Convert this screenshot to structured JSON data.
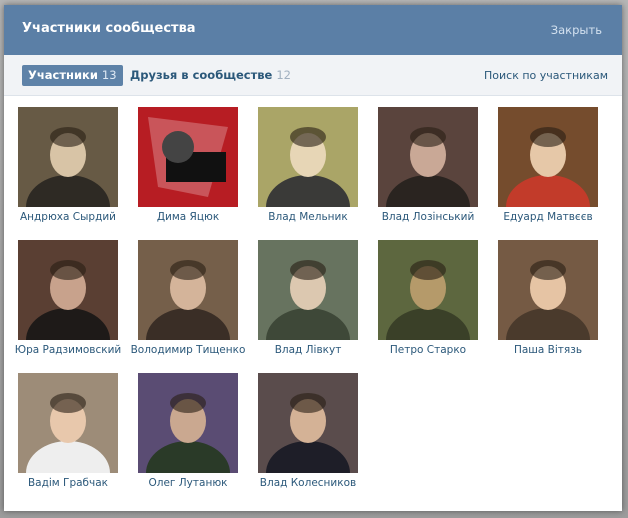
{
  "modal": {
    "title": "Участники сообщества",
    "close_label": "Закрыть"
  },
  "tabs": {
    "members_label": "Участники",
    "members_count": "13",
    "friends_label": "Друзья в сообществе",
    "friends_count": "12",
    "search_label": "Поиск по участникам"
  },
  "members": [
    {
      "name": "Андрюха Сырдий",
      "colors": [
        "#7a6a52",
        "#2e2a24",
        "#d8c4a6"
      ]
    },
    {
      "name": "Дима Яцюк",
      "colors": [
        "#d8232a",
        "#1a1a1a",
        "#ffffff"
      ]
    },
    {
      "name": "Влад Мельник",
      "colors": [
        "#c8c27a",
        "#3a3a38",
        "#e7d6b6"
      ]
    },
    {
      "name": "Влад Лозінський",
      "colors": [
        "#6a5048",
        "#2a2420",
        "#c9a896"
      ]
    },
    {
      "name": "Едуард Матвєєв",
      "colors": [
        "#8a5a36",
        "#c23b2a",
        "#e6c8a8"
      ]
    },
    {
      "name": "Юра Радзимовский",
      "colors": [
        "#6a4a3c",
        "#1e1a18",
        "#c8a28c"
      ]
    },
    {
      "name": "Володимир Тищенко",
      "colors": [
        "#8a7058",
        "#3a2e26",
        "#d4b49a"
      ]
    },
    {
      "name": "Влад Лівкут",
      "colors": [
        "#7a8870",
        "#3e4838",
        "#dcc8b0"
      ]
    },
    {
      "name": "Петро Старко",
      "colors": [
        "#6e7a4a",
        "#3a4028",
        "#b59a6a"
      ]
    },
    {
      "name": "Паша Вітязь",
      "colors": [
        "#8a6a50",
        "#4a3a2c",
        "#e6c4a4"
      ]
    },
    {
      "name": "Вадім Грабчак",
      "colors": [
        "#b9a58e",
        "#eeeeee",
        "#e8c8ac"
      ]
    },
    {
      "name": "Олег Лутанюк",
      "colors": [
        "#6a5a88",
        "#2a3a28",
        "#caa890"
      ]
    },
    {
      "name": "Влад Колесников",
      "colors": [
        "#6a5a5a",
        "#1e1e28",
        "#d4b296"
      ]
    }
  ]
}
